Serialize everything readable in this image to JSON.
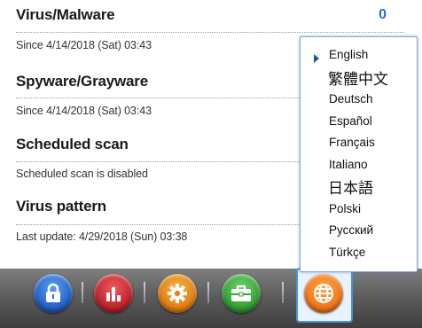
{
  "sections": {
    "virus": {
      "title": "Virus/Malware",
      "count": "0",
      "subtitle": "Since 4/14/2018 (Sat) 03:43"
    },
    "spyware": {
      "title": "Spyware/Grayware",
      "subtitle": "Since 4/14/2018 (Sat) 03:43"
    },
    "scheduled": {
      "title": "Scheduled scan",
      "subtitle": "Scheduled scan is disabled"
    },
    "pattern": {
      "title": "Virus pattern",
      "subtitle": "Last update: 4/29/2018 (Sun) 03:38"
    }
  },
  "language_menu": {
    "selected": "English",
    "items": [
      "English",
      "繁體中文",
      "Deutsch",
      "Español",
      "Français",
      "Italiano",
      "日本語",
      "Polski",
      "Русский",
      "Türkçe"
    ]
  },
  "dock": {
    "buttons": [
      {
        "icon": "lock-icon",
        "color": "#2f6fd0"
      },
      {
        "icon": "bar-chart-icon",
        "color": "#c8262d"
      },
      {
        "icon": "gear-icon",
        "color": "#e3861c"
      },
      {
        "icon": "toolbox-icon",
        "color": "#3aa23a"
      },
      {
        "icon": "globe-icon",
        "color": "#f07a14"
      }
    ]
  }
}
